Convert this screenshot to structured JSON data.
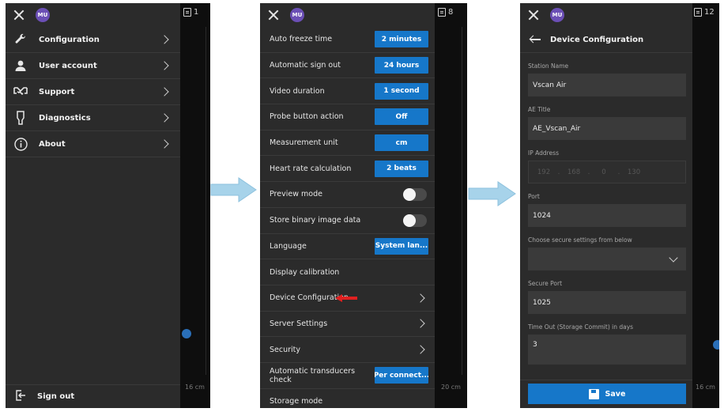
{
  "avatar_initials": "MU",
  "accent": "#1677c9",
  "panel1": {
    "badge": "1",
    "menu": [
      {
        "label": "Configuration",
        "icon": "wrench-icon"
      },
      {
        "label": "User account",
        "icon": "user-icon"
      },
      {
        "label": "Support",
        "icon": "handshake-icon"
      },
      {
        "label": "Diagnostics",
        "icon": "probe-icon"
      },
      {
        "label": "About",
        "icon": "info-icon"
      }
    ],
    "sign_out": "Sign out",
    "ruler_text": "16 cm"
  },
  "panel2": {
    "badge": "8",
    "rows": [
      {
        "label": "Auto freeze time",
        "kind": "button",
        "value": "2 minutes"
      },
      {
        "label": "Automatic sign out",
        "kind": "button",
        "value": "24 hours"
      },
      {
        "label": "Video duration",
        "kind": "button",
        "value": "1 second"
      },
      {
        "label": "Probe button action",
        "kind": "button",
        "value": "Off"
      },
      {
        "label": "Measurement unit",
        "kind": "button",
        "value": "cm"
      },
      {
        "label": "Heart rate calculation",
        "kind": "button",
        "value": "2 beats"
      },
      {
        "label": "Preview mode",
        "kind": "toggle",
        "value": "off"
      },
      {
        "label": "Store binary image data",
        "kind": "toggle",
        "value": "off"
      },
      {
        "label": "Language",
        "kind": "button",
        "value": "System lan..."
      },
      {
        "label": "Display calibration",
        "kind": "none"
      },
      {
        "label": "Device Configuration",
        "kind": "chevron",
        "highlight": true
      },
      {
        "label": "Server Settings",
        "kind": "chevron"
      },
      {
        "label": "Security",
        "kind": "chevron"
      },
      {
        "label": "Automatic transducers check",
        "kind": "button",
        "value": "Per connect..."
      },
      {
        "label": "Storage mode",
        "kind": "none"
      }
    ],
    "ruler_text": "20 cm"
  },
  "panel3": {
    "badge": "12",
    "title": "Device Configuration",
    "station_name_label": "Station Name",
    "station_name_value": "Vscan Air",
    "ae_title_label": "AE Title",
    "ae_title_value": "AE_Vscan_Air",
    "ip_label": "IP Address",
    "ip_parts": [
      "192",
      "168",
      "0",
      "130"
    ],
    "port_label": "Port",
    "port_value": "1024",
    "secure_settings_label": "Choose secure settings from below",
    "secure_settings_value": "",
    "secure_port_label": "Secure Port",
    "secure_port_value": "1025",
    "timeout_label": "Time Out (Storage Commit) in days",
    "timeout_value": "3",
    "save_label": "Save",
    "ruler_text": "16 cm"
  }
}
